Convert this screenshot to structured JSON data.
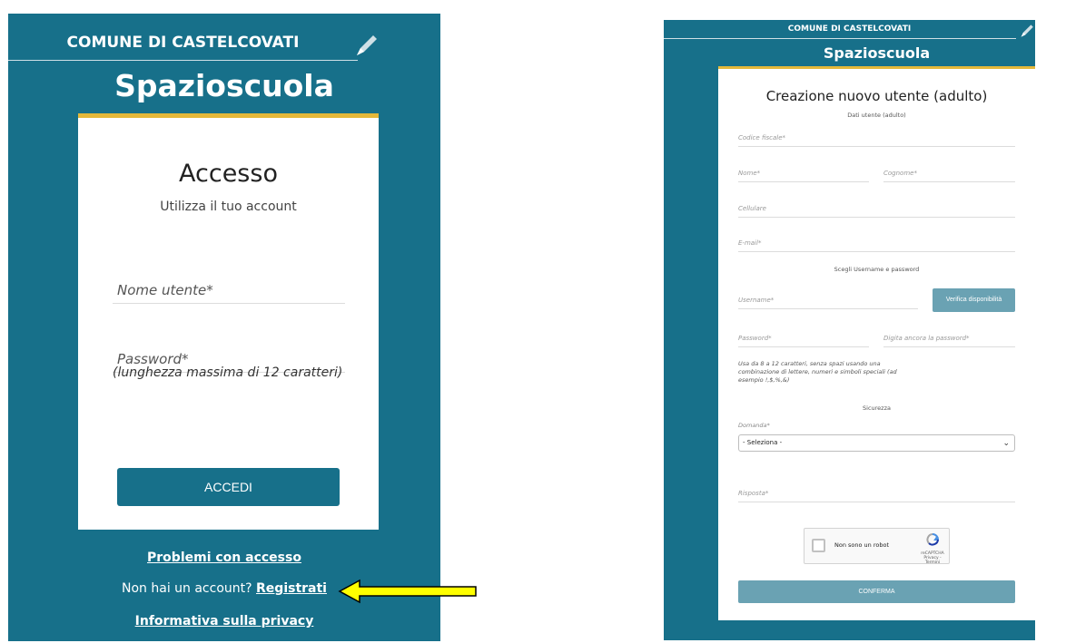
{
  "login": {
    "municipality": "COMUNE DI CASTELCOVATI",
    "brand": "Spazioscuola",
    "title": "Accesso",
    "subtitle": "Utilizza il tuo account",
    "username_placeholder": "Nome utente*",
    "password_placeholder": "Password*",
    "password_hint": "(lunghezza massima di 12 caratteri)",
    "submit_label": "ACCEDI",
    "problems_link": "Problemi con accesso",
    "no_account_text": "Non hai un account?",
    "register_link": "Registrati",
    "privacy_link": "Informativa sulla privacy"
  },
  "register": {
    "municipality": "COMUNE DI CASTELCOVATI",
    "brand": "Spazioscuola",
    "title": "Creazione nuovo utente (adulto)",
    "section_user_data": "Dati utente (adulto)",
    "codice_fiscale": "Codice fiscale*",
    "nome": "Nome*",
    "cognome": "Cognome*",
    "cellulare": "Cellulare",
    "email": "E-mail*",
    "section_credentials": "Scegli Username e password",
    "username": "Username*",
    "verify_label": "Verifica disponibilità",
    "password": "Password*",
    "password_repeat": "Digita ancora la password*",
    "password_hint": "Usa da 8 a 12 caratteri, senza spazi usando una combinazione di lettere, numeri e simboli speciali (ad esempio !,$,%,&)",
    "section_security": "Sicurezza",
    "question_label": "Domanda*",
    "question_selected": "- Seleziona -",
    "answer": "Risposta*",
    "captcha_label": "Non sono un robot",
    "captcha_brand": "reCAPTCHA",
    "captcha_terms": "Privacy - Termini",
    "confirm_label": "CONFERMA"
  },
  "colors": {
    "teal": "#17708a",
    "gold": "#e4b83a",
    "arrow": "#ffff00",
    "button_light": "#6aa2b3"
  }
}
